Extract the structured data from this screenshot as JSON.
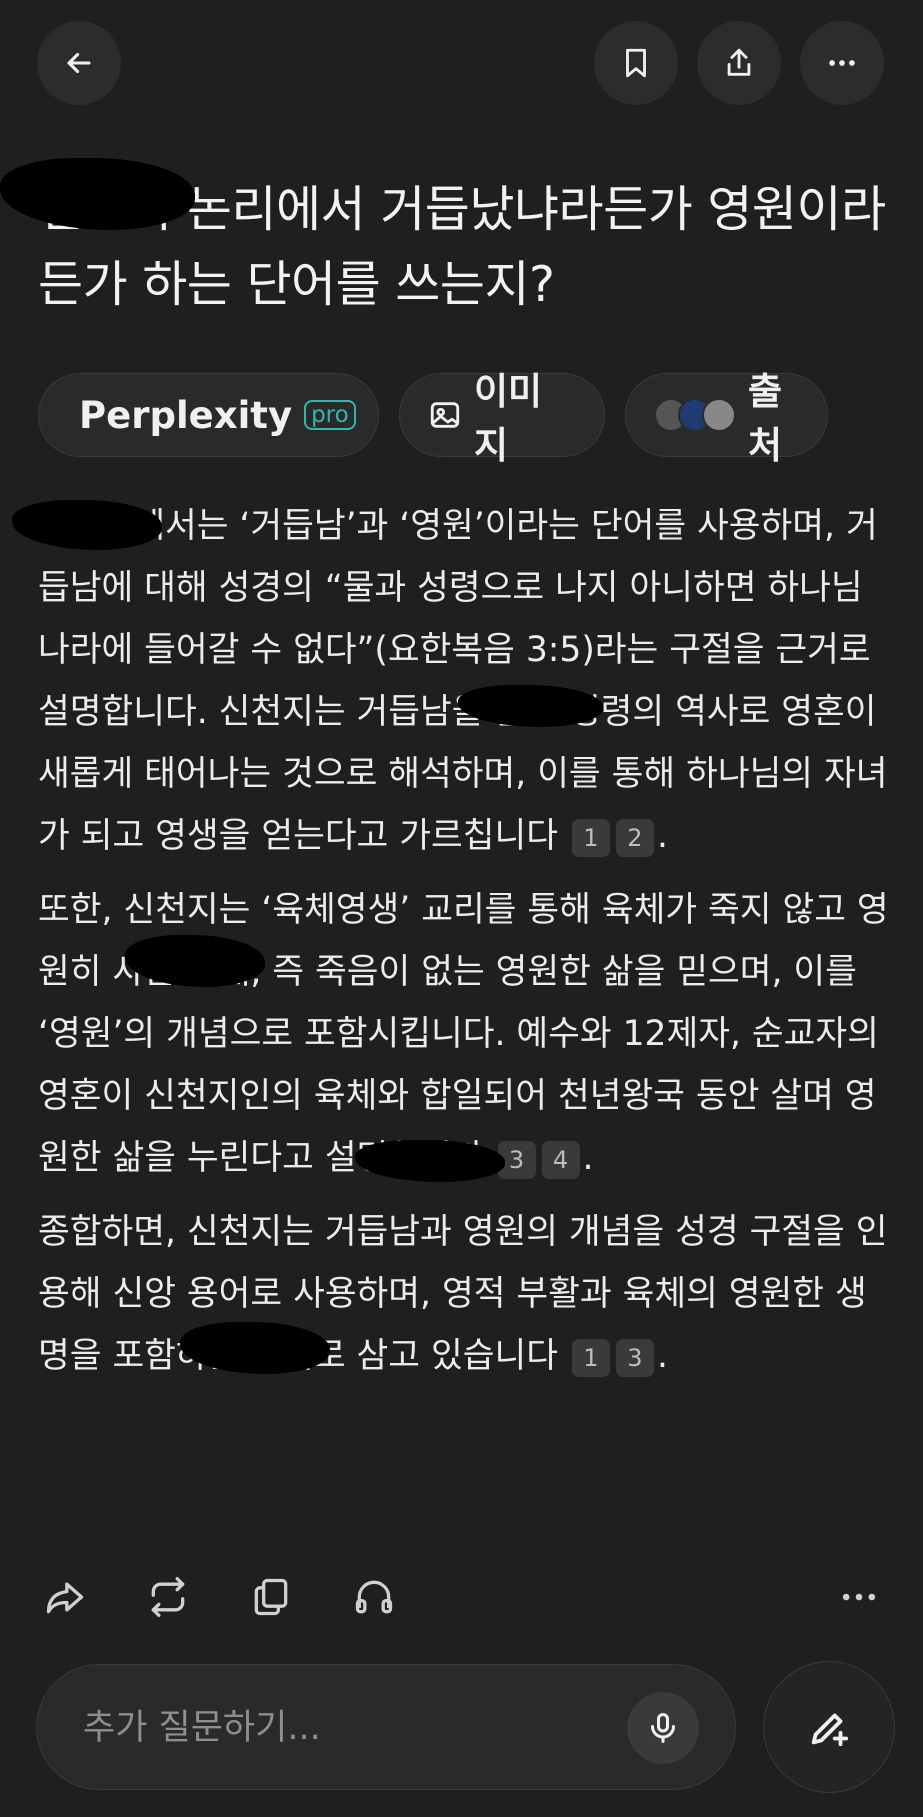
{
  "header": {
    "back_icon": "arrow-left-icon",
    "bookmark_icon": "bookmark-icon",
    "share_icon": "share-icon",
    "more_icon": "more-horizontal-icon"
  },
  "question": {
    "title": "신천지 논리에서 거듭났냐라든가 영원이라든가 하는 단어를 쓰는지?"
  },
  "chips": {
    "perplexity_label": "Perplexity",
    "pro_badge": "pro",
    "images_label": "이미지",
    "sources_label": "출처"
  },
  "answer": {
    "p1_text": "신천지에서는 ‘거듭남’과 ‘영원’이라는 단어를 사용하며, 거듭남에 대해 성경의 “물과 성령으로 나지 아니하면 하나님 나라에 들어갈 수 없다”(요한복음 3:5)라는 구절을 근거로 설명합니다. 신천지는 거듭남을 물과 성령의 역사로 영혼이 새롭게 태어나는 것으로 해석하며, 이를 통해 하나님의 자녀가 되고 영생을 얻는다고 가르칩니다",
    "p1_cites": [
      "1",
      "2"
    ],
    "p2_text": "또한, 신천지는 ‘육체영생’ 교리를 통해 육체가 죽지 않고 영원히 사는 상태, 즉 죽음이 없는 영원한 삶을 믿으며, 이를 ‘영원’의 개념으로 포함시킵니다. 예수와 12제자, 순교자의 영혼이 신천지인의 육체와 합일되어 천년왕국 동안 살며 영원한 삶을 누린다고 설명합니다",
    "p2_cites": [
      "3",
      "4"
    ],
    "p3_text": "종합하면, 신천지는 거듭남과 영원의 개념을 성경 구절을 인용해 신앙 용어로 사용하며, 영적 부활과 육체의 영원한 생명을 포함하는 교리로 삼고 있습니다",
    "p3_cites": [
      "1",
      "3"
    ],
    "period": "."
  },
  "actions": {
    "share_icon": "forward-icon",
    "rewrite_icon": "repeat-icon",
    "copy_icon": "copy-icon",
    "listen_icon": "headphones-icon",
    "more_icon": "more-horizontal-icon"
  },
  "composer": {
    "placeholder": "추가 질문하기...",
    "mic_icon": "microphone-icon",
    "new_thread_icon": "pencil-plus-icon"
  },
  "colors": {
    "background": "#1f1f1f",
    "surface": "#2a2a2a",
    "pro_accent": "#34b5b0",
    "text": "#ececec"
  }
}
